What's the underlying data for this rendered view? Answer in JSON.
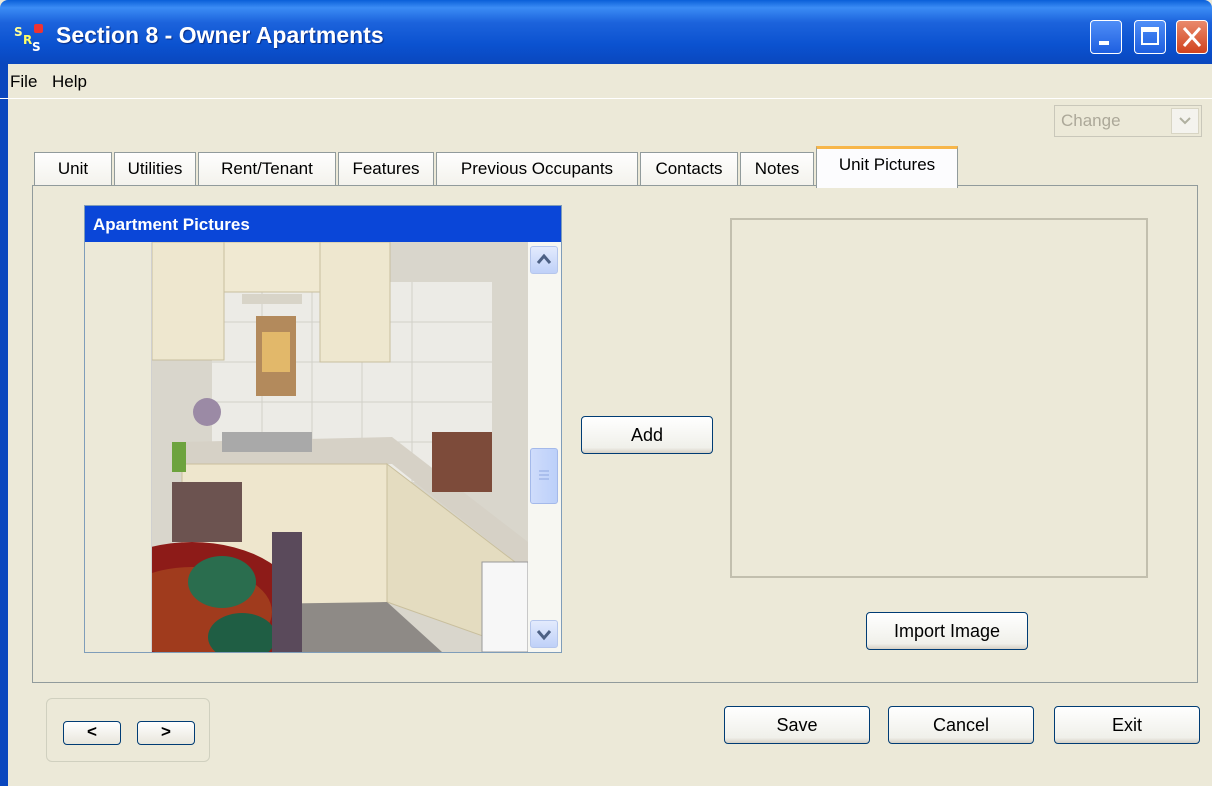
{
  "window": {
    "title": "Section 8 - Owner Apartments"
  },
  "menu": {
    "items": [
      {
        "label": "File"
      },
      {
        "label": "Help"
      }
    ]
  },
  "mode_select": {
    "value": "Change"
  },
  "tabs": [
    {
      "label": "Unit"
    },
    {
      "label": "Utilities"
    },
    {
      "label": "Rent/Tenant"
    },
    {
      "label": "Features"
    },
    {
      "label": "Previous Occupants"
    },
    {
      "label": "Contacts"
    },
    {
      "label": "Notes"
    },
    {
      "label": "Unit Pictures",
      "active": true
    }
  ],
  "pictures_panel": {
    "header": "Apartment Pictures"
  },
  "buttons": {
    "add": "Add",
    "import_image": "Import Image",
    "save": "Save",
    "cancel": "Cancel",
    "exit": "Exit",
    "prev": "<",
    "next": ">"
  },
  "icons": {
    "minimize": "minimize-icon",
    "maximize": "maximize-icon",
    "close": "close-icon",
    "dropdown": "chevron-down-icon",
    "scroll_up": "chevron-up-icon",
    "scroll_down": "chevron-down-icon"
  },
  "colors": {
    "titlebar": "#0a47be",
    "panel_header": "#0a46d8",
    "active_tab_accent": "#f7b64a"
  }
}
